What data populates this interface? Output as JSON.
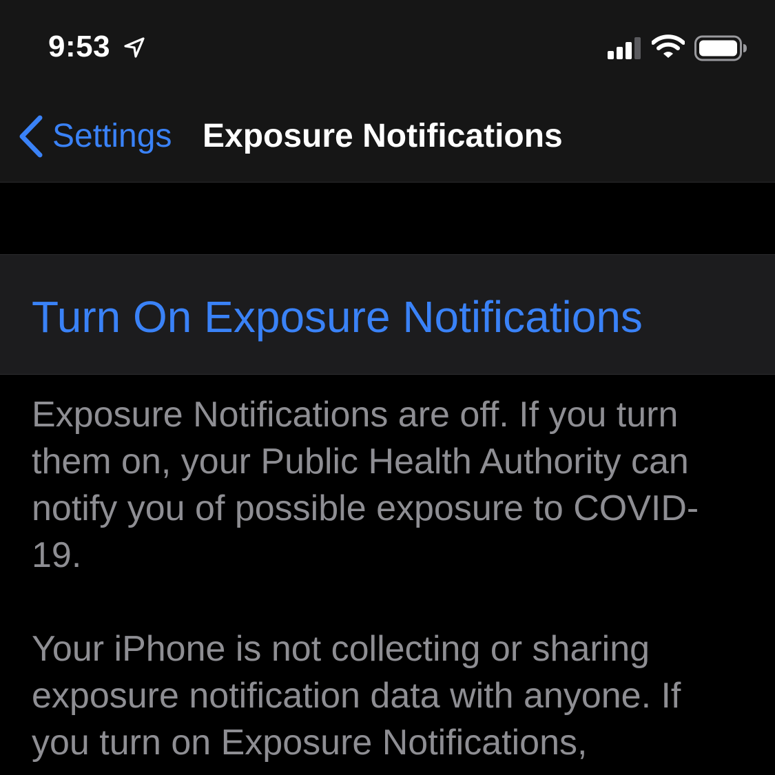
{
  "status_bar": {
    "time": "9:53",
    "icons": [
      "location-arrow-icon",
      "cellular-signal-icon",
      "wifi-icon",
      "battery-icon"
    ]
  },
  "nav": {
    "back_label": "Settings",
    "title": "Exposure Notifications"
  },
  "action": {
    "label": "Turn On Exposure Notifications"
  },
  "footer": {
    "paragraphs": [
      "Exposure Notifications are off. If you turn them on, your Public Health Authority can notify you of possible exposure to COVID-19.",
      "Your iPhone is not collecting or sharing exposure notification data with anyone. If you turn on Exposure Notifications, information about the"
    ]
  },
  "colors": {
    "accent": "#3a82f7",
    "background": "#000000",
    "bar": "#161616",
    "cell": "#1c1c1e",
    "secondary_text": "#8e8e93"
  }
}
